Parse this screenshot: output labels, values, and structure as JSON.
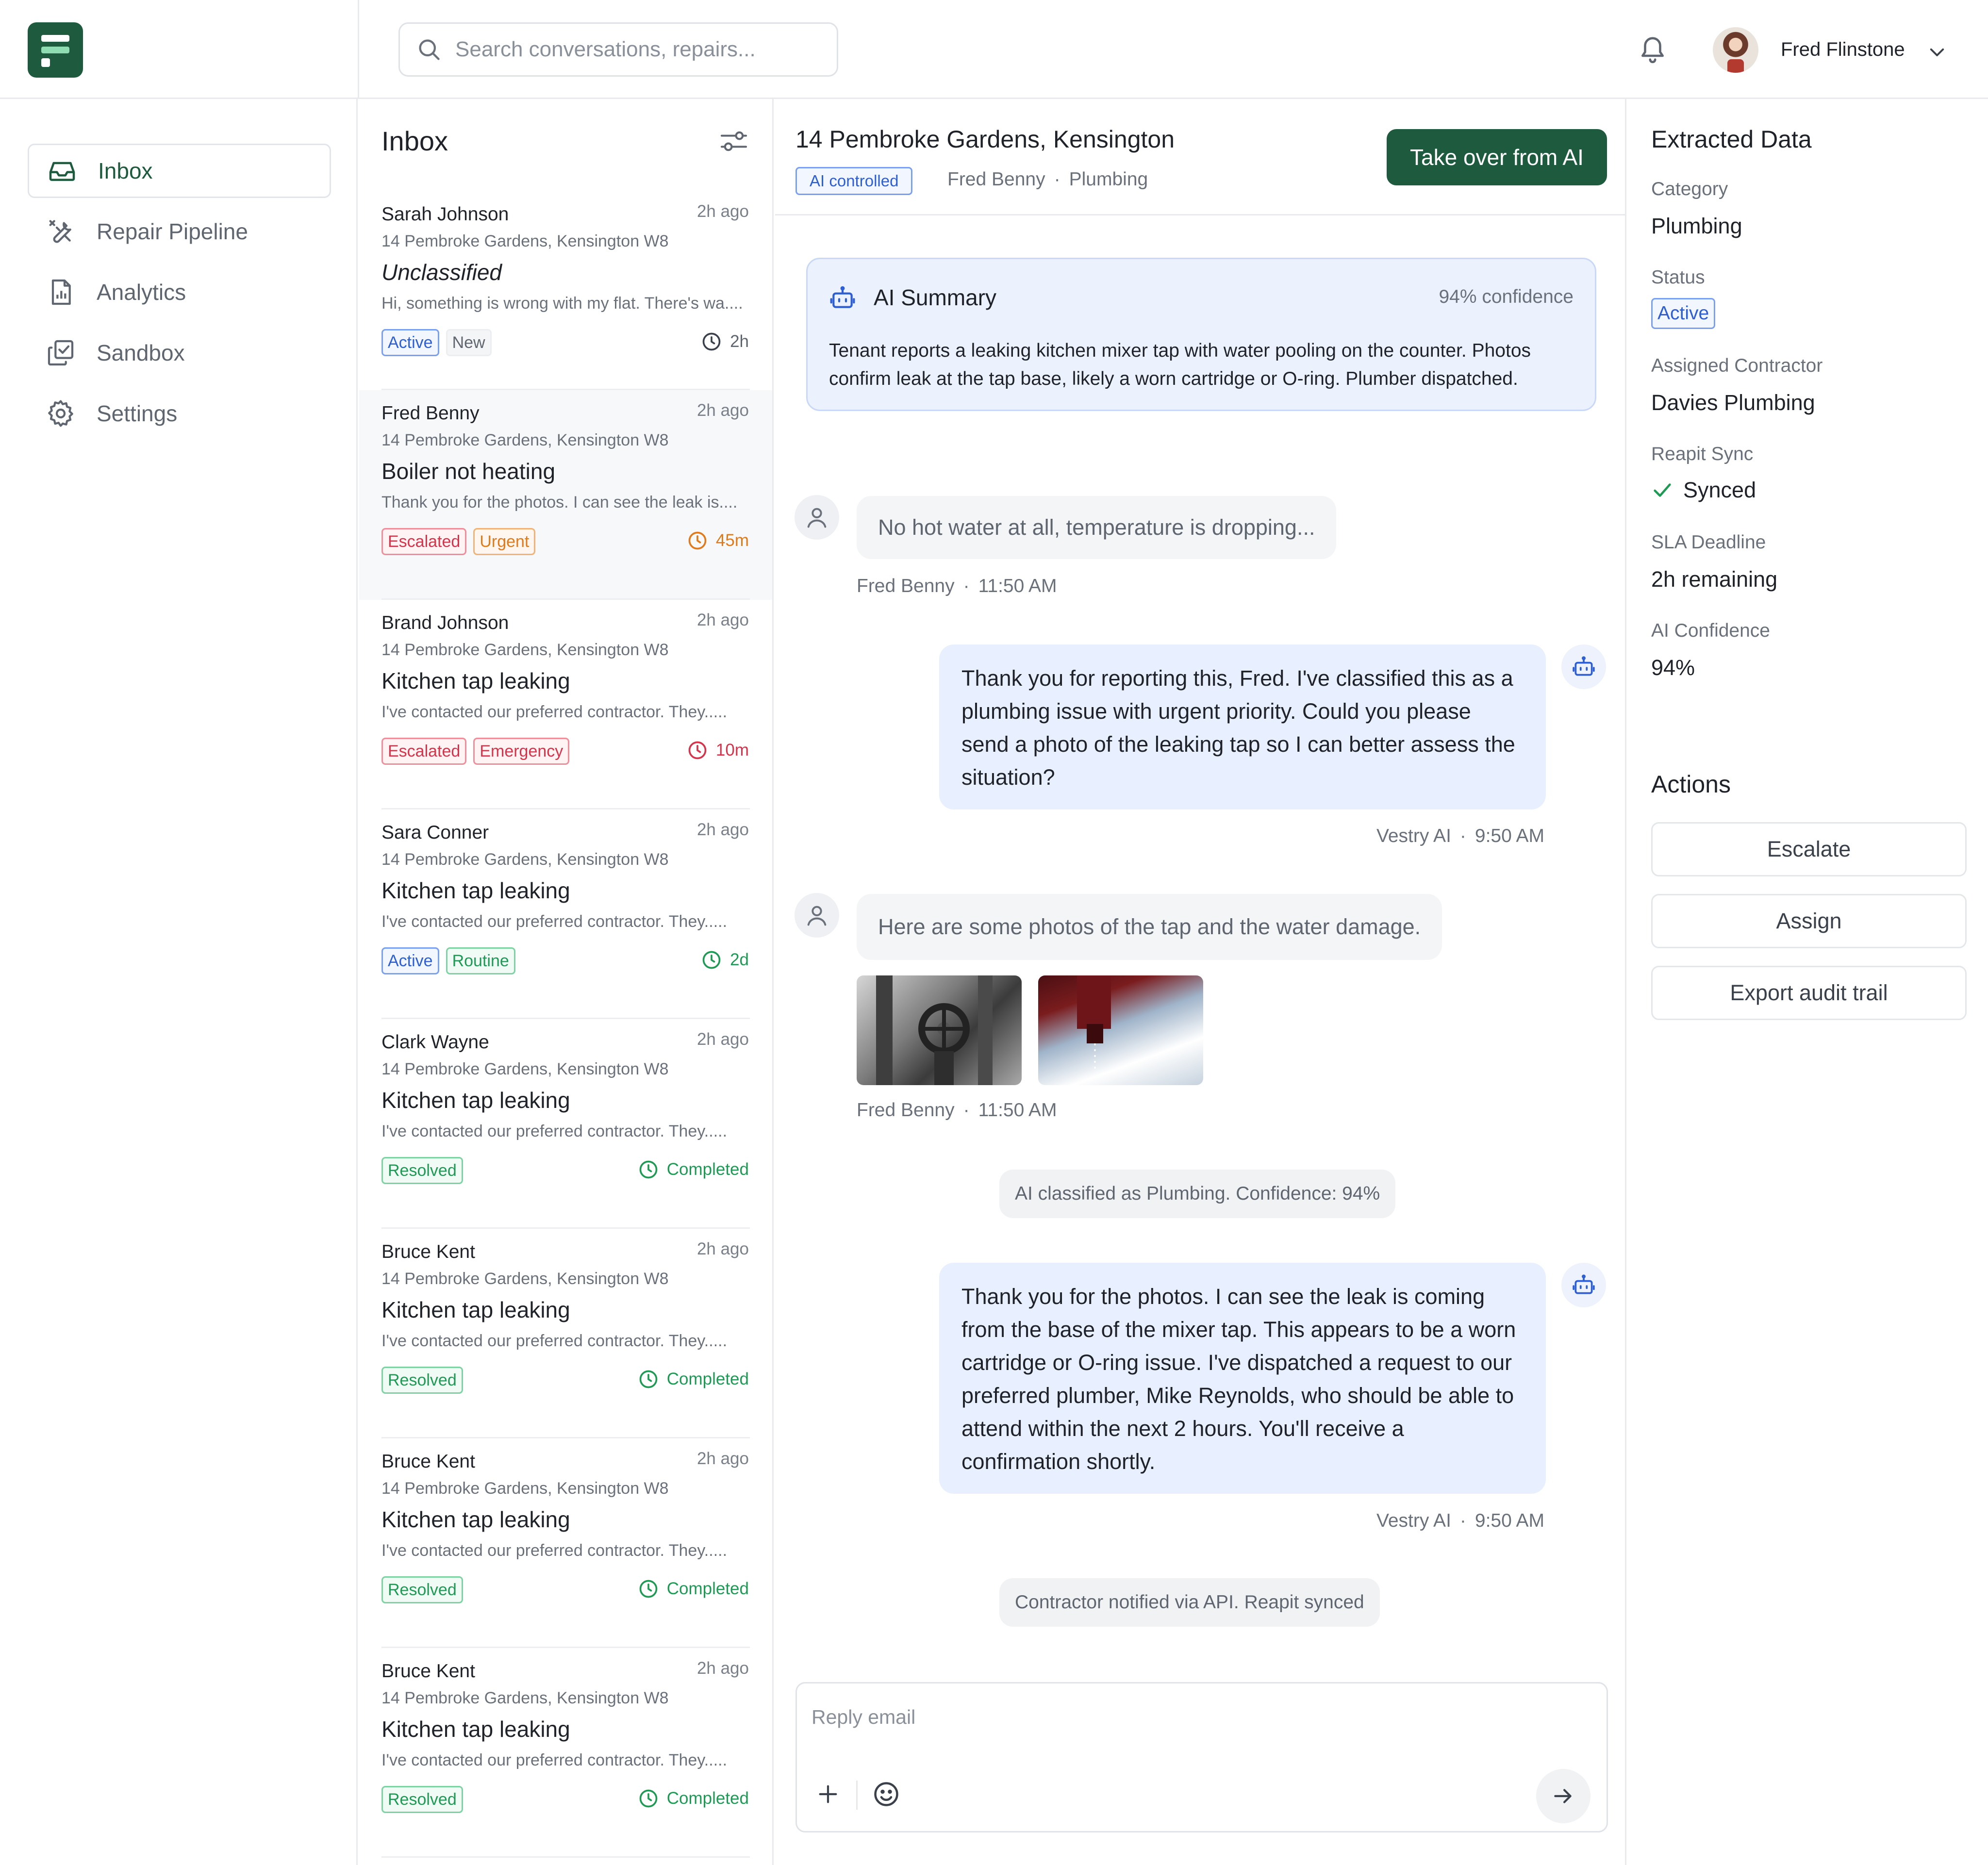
{
  "search": {
    "placeholder": "Search conversations, repairs..."
  },
  "user": {
    "name": "Fred Flinstone"
  },
  "nav": {
    "items": [
      {
        "label": "Inbox",
        "icon": "inbox-icon"
      },
      {
        "label": "Repair Pipeline",
        "icon": "tools-icon"
      },
      {
        "label": "Analytics",
        "icon": "analytics-icon"
      },
      {
        "label": "Sandbox",
        "icon": "sandbox-icon"
      },
      {
        "label": "Settings",
        "icon": "gear-icon"
      }
    ]
  },
  "inbox": {
    "title": "Inbox",
    "conversations": [
      {
        "name": "Sarah Johnson",
        "time": "2h ago",
        "address": "14 Pembroke Gardens, Kensington W8",
        "subject": "Unclassified",
        "preview": "Hi, something is wrong with my flat. There's  wa....",
        "tags": [
          "Active",
          "New"
        ],
        "due": "2h"
      },
      {
        "name": "Fred Benny",
        "time": "2h ago",
        "address": "14 Pembroke Gardens, Kensington W8",
        "subject": "Boiler not heating",
        "preview": "Thank you for the photos. I can see the leak is....",
        "tags": [
          "Escalated",
          "Urgent"
        ],
        "due": "45m"
      },
      {
        "name": "Brand Johnson",
        "time": "2h ago",
        "address": "14 Pembroke Gardens, Kensington W8",
        "subject": "Kitchen tap leaking",
        "preview": "I've contacted our preferred contractor. They.....",
        "tags": [
          "Escalated",
          "Emergency"
        ],
        "due": "10m"
      },
      {
        "name": "Sara Conner",
        "time": "2h ago",
        "address": "14 Pembroke Gardens, Kensington W8",
        "subject": "Kitchen tap leaking",
        "preview": "I've contacted our preferred contractor. They.....",
        "tags": [
          "Active",
          "Routine"
        ],
        "due": "2d"
      },
      {
        "name": "Clark Wayne",
        "time": "2h ago",
        "address": "14 Pembroke Gardens, Kensington W8",
        "subject": "Kitchen tap leaking",
        "preview": "I've contacted our preferred contractor. They.....",
        "tags": [
          "Resolved"
        ],
        "due": "Completed"
      },
      {
        "name": "Bruce Kent",
        "time": "2h ago",
        "address": "14 Pembroke Gardens, Kensington W8",
        "subject": "Kitchen tap leaking",
        "preview": "I've contacted our preferred contractor. They.....",
        "tags": [
          "Resolved"
        ],
        "due": "Completed"
      },
      {
        "name": "Bruce Kent",
        "time": "2h ago",
        "address": "14 Pembroke Gardens, Kensington W8",
        "subject": "Kitchen tap leaking",
        "preview": "I've contacted our preferred contractor. They.....",
        "tags": [
          "Resolved"
        ],
        "due": "Completed"
      },
      {
        "name": "Bruce Kent",
        "time": "2h ago",
        "address": "14 Pembroke Gardens, Kensington W8",
        "subject": "Kitchen tap leaking",
        "preview": "I've contacted our preferred contractor. They.....",
        "tags": [
          "Resolved"
        ],
        "due": "Completed"
      }
    ]
  },
  "conversation": {
    "title": "14 Pembroke Gardens, Kensington",
    "badge": "AI controlled",
    "tenant": "Fred Benny",
    "category": "Plumbing",
    "takeover_label": "Take over from AI",
    "summary": {
      "heading": "AI Summary",
      "confidence": "94% confidence",
      "text": "Tenant reports a leaking kitchen mixer tap with water pooling on the counter. Photos confirm leak at the tap base, likely a worn cartridge or O-ring. Plumber dispatched."
    },
    "messages": [
      {
        "text": "No hot water at all, temperature is dropping...",
        "author": "Fred Benny",
        "time": "11:50 AM"
      },
      {
        "text": "Thank you for reporting this, Fred. I've classified this as a plumbing issue with urgent priority. Could you please send a photo of the leaking tap so I can better assess the situation?",
        "author": "Vestry AI",
        "time": "9:50 AM"
      },
      {
        "text": "Here are some photos of the tap and the water damage.",
        "author": "Fred Benny",
        "time": "11:50 AM"
      },
      {
        "text": "AI classified as Plumbing. Confidence: 94%"
      },
      {
        "text": "Thank you for the photos. I can see the leak is coming from the base of the mixer tap. This appears to be a worn cartridge or O-ring issue. I've dispatched a request to our preferred plumber, Mike Reynolds, who should be able to attend within the next 2 hours. You'll receive a confirmation shortly.",
        "author": "Vestry AI",
        "time": "9:50 AM"
      },
      {
        "text": "Contractor notified via API. Reapit synced"
      }
    ],
    "reply_placeholder": "Reply email"
  },
  "extracted": {
    "title": "Extracted Data",
    "category_label": "Category",
    "category_value": "Plumbing",
    "status_label": "Status",
    "status_value": "Active",
    "contractor_label": "Assigned Contractor",
    "contractor_value": "Davies Plumbing",
    "sync_label": "Reapit Sync",
    "sync_value": "Synced",
    "sla_label": "SLA Deadline",
    "sla_value": "2h remaining",
    "confidence_label": "AI Confidence",
    "confidence_value": "94%"
  },
  "actions": {
    "title": "Actions",
    "escalate": "Escalate",
    "assign": "Assign",
    "export": "Export audit trail"
  },
  "colors": {
    "brand": "#1e5b3e",
    "active_blue": "#2d5fd3",
    "escalated_red": "#d5344a",
    "urgent_orange": "#e07a1a",
    "resolved_green": "#1f9a55"
  }
}
